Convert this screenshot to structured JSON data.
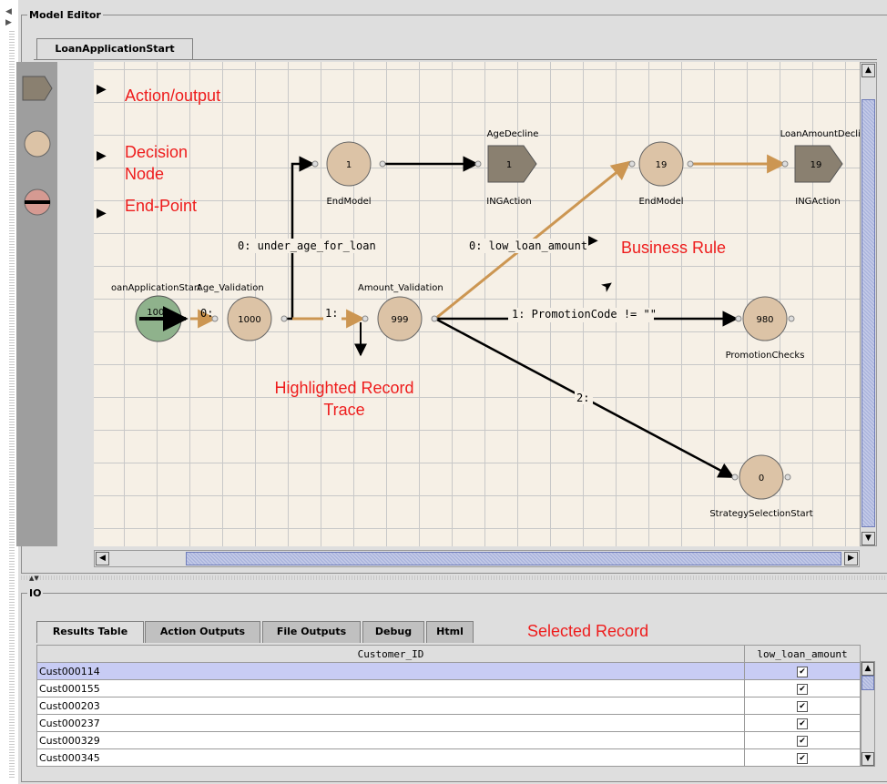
{
  "model_editor": {
    "legend": "Model Editor",
    "tab": "LoanApplicationStart"
  },
  "palette": [
    {
      "icon": "action-output-icon",
      "label": "Action/output"
    },
    {
      "icon": "decision-node-icon",
      "label": "Decision Node"
    },
    {
      "icon": "end-point-icon",
      "label": "End-Point"
    }
  ],
  "nodes": {
    "start": {
      "title": "oanApplicationStart",
      "value": "1000"
    },
    "age": {
      "title": "Age_Validation",
      "value": "1000"
    },
    "amount": {
      "title": "Amount_Validation",
      "value": "999"
    },
    "endmodel1": {
      "value": "1",
      "label": "EndModel"
    },
    "agedecline": {
      "title": "AgeDecline",
      "value": "1",
      "label": "INGAction"
    },
    "endmodel2": {
      "value": "19",
      "label": "EndModel"
    },
    "loandecline": {
      "title": "LoanAmountDecline",
      "value": "19",
      "label": "INGAction"
    },
    "promo": {
      "value": "980",
      "label": "PromotionChecks"
    },
    "strategy": {
      "value": "0",
      "label": "StrategySelectionStart"
    }
  },
  "edges": {
    "start_age": "0:",
    "age_underage": "0: under_age_for_loan",
    "age_amount": "1:",
    "amount_low": "0: low_loan_amount",
    "amount_promo": "1: PromotionCode != \"\"",
    "amount_strategy": "2:"
  },
  "annotations": {
    "business_rule": "Business Rule",
    "highlighted": "Highlighted Record Trace",
    "selected": "Selected Record"
  },
  "io": {
    "legend": "IO",
    "tabs": [
      "Results Table",
      "Action Outputs",
      "File Outputs",
      "Debug",
      "Html"
    ],
    "active_tab": "Results Table",
    "columns": [
      "Customer_ID",
      "low_loan_amount"
    ],
    "rows": [
      {
        "id": "Cust000114",
        "checked": true,
        "selected": true
      },
      {
        "id": "Cust000155",
        "checked": true,
        "selected": false
      },
      {
        "id": "Cust000203",
        "checked": true,
        "selected": false
      },
      {
        "id": "Cust000237",
        "checked": true,
        "selected": false
      },
      {
        "id": "Cust000329",
        "checked": true,
        "selected": false
      },
      {
        "id": "Cust000345",
        "checked": true,
        "selected": false
      }
    ]
  },
  "colors": {
    "highlight_edge": "#cc9652",
    "decision_fill": "#dcc3a6",
    "start_fill": "#8fb28c",
    "action_fill": "#8a8070",
    "annotation": "#ee1c1c",
    "selected_row": "#c8ccf4"
  }
}
